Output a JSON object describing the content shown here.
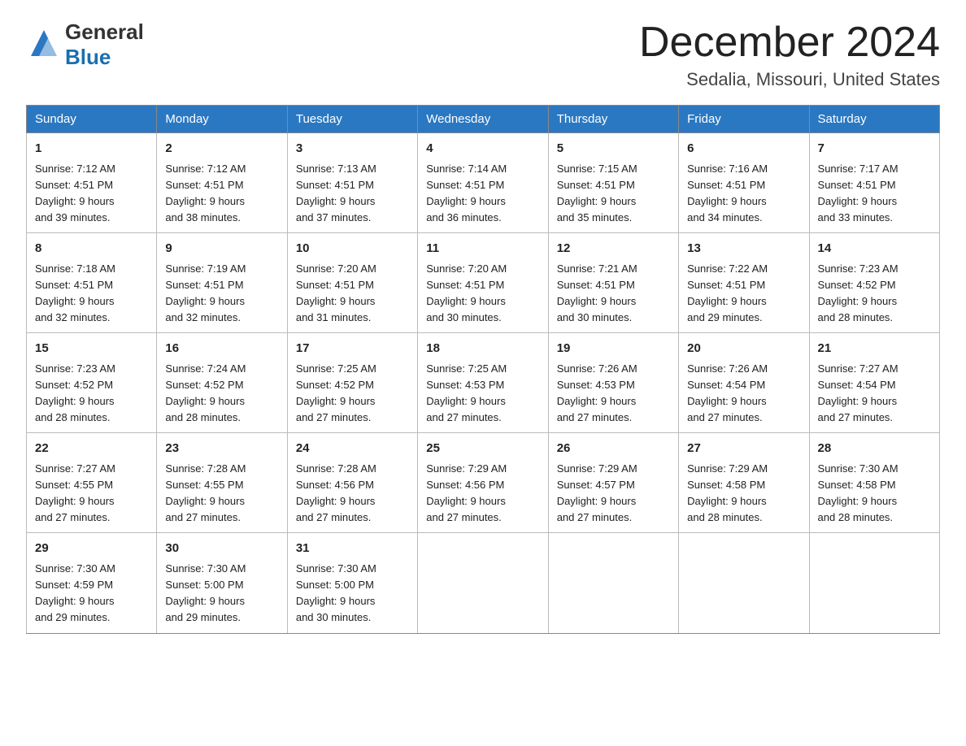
{
  "logo": {
    "general": "General",
    "blue": "Blue"
  },
  "title": {
    "month_year": "December 2024",
    "location": "Sedalia, Missouri, United States"
  },
  "days_of_week": [
    "Sunday",
    "Monday",
    "Tuesday",
    "Wednesday",
    "Thursday",
    "Friday",
    "Saturday"
  ],
  "weeks": [
    [
      {
        "day": "1",
        "sunrise": "7:12 AM",
        "sunset": "4:51 PM",
        "daylight": "9 hours and 39 minutes."
      },
      {
        "day": "2",
        "sunrise": "7:12 AM",
        "sunset": "4:51 PM",
        "daylight": "9 hours and 38 minutes."
      },
      {
        "day": "3",
        "sunrise": "7:13 AM",
        "sunset": "4:51 PM",
        "daylight": "9 hours and 37 minutes."
      },
      {
        "day": "4",
        "sunrise": "7:14 AM",
        "sunset": "4:51 PM",
        "daylight": "9 hours and 36 minutes."
      },
      {
        "day": "5",
        "sunrise": "7:15 AM",
        "sunset": "4:51 PM",
        "daylight": "9 hours and 35 minutes."
      },
      {
        "day": "6",
        "sunrise": "7:16 AM",
        "sunset": "4:51 PM",
        "daylight": "9 hours and 34 minutes."
      },
      {
        "day": "7",
        "sunrise": "7:17 AM",
        "sunset": "4:51 PM",
        "daylight": "9 hours and 33 minutes."
      }
    ],
    [
      {
        "day": "8",
        "sunrise": "7:18 AM",
        "sunset": "4:51 PM",
        "daylight": "9 hours and 32 minutes."
      },
      {
        "day": "9",
        "sunrise": "7:19 AM",
        "sunset": "4:51 PM",
        "daylight": "9 hours and 32 minutes."
      },
      {
        "day": "10",
        "sunrise": "7:20 AM",
        "sunset": "4:51 PM",
        "daylight": "9 hours and 31 minutes."
      },
      {
        "day": "11",
        "sunrise": "7:20 AM",
        "sunset": "4:51 PM",
        "daylight": "9 hours and 30 minutes."
      },
      {
        "day": "12",
        "sunrise": "7:21 AM",
        "sunset": "4:51 PM",
        "daylight": "9 hours and 30 minutes."
      },
      {
        "day": "13",
        "sunrise": "7:22 AM",
        "sunset": "4:51 PM",
        "daylight": "9 hours and 29 minutes."
      },
      {
        "day": "14",
        "sunrise": "7:23 AM",
        "sunset": "4:52 PM",
        "daylight": "9 hours and 28 minutes."
      }
    ],
    [
      {
        "day": "15",
        "sunrise": "7:23 AM",
        "sunset": "4:52 PM",
        "daylight": "9 hours and 28 minutes."
      },
      {
        "day": "16",
        "sunrise": "7:24 AM",
        "sunset": "4:52 PM",
        "daylight": "9 hours and 28 minutes."
      },
      {
        "day": "17",
        "sunrise": "7:25 AM",
        "sunset": "4:52 PM",
        "daylight": "9 hours and 27 minutes."
      },
      {
        "day": "18",
        "sunrise": "7:25 AM",
        "sunset": "4:53 PM",
        "daylight": "9 hours and 27 minutes."
      },
      {
        "day": "19",
        "sunrise": "7:26 AM",
        "sunset": "4:53 PM",
        "daylight": "9 hours and 27 minutes."
      },
      {
        "day": "20",
        "sunrise": "7:26 AM",
        "sunset": "4:54 PM",
        "daylight": "9 hours and 27 minutes."
      },
      {
        "day": "21",
        "sunrise": "7:27 AM",
        "sunset": "4:54 PM",
        "daylight": "9 hours and 27 minutes."
      }
    ],
    [
      {
        "day": "22",
        "sunrise": "7:27 AM",
        "sunset": "4:55 PM",
        "daylight": "9 hours and 27 minutes."
      },
      {
        "day": "23",
        "sunrise": "7:28 AM",
        "sunset": "4:55 PM",
        "daylight": "9 hours and 27 minutes."
      },
      {
        "day": "24",
        "sunrise": "7:28 AM",
        "sunset": "4:56 PM",
        "daylight": "9 hours and 27 minutes."
      },
      {
        "day": "25",
        "sunrise": "7:29 AM",
        "sunset": "4:56 PM",
        "daylight": "9 hours and 27 minutes."
      },
      {
        "day": "26",
        "sunrise": "7:29 AM",
        "sunset": "4:57 PM",
        "daylight": "9 hours and 27 minutes."
      },
      {
        "day": "27",
        "sunrise": "7:29 AM",
        "sunset": "4:58 PM",
        "daylight": "9 hours and 28 minutes."
      },
      {
        "day": "28",
        "sunrise": "7:30 AM",
        "sunset": "4:58 PM",
        "daylight": "9 hours and 28 minutes."
      }
    ],
    [
      {
        "day": "29",
        "sunrise": "7:30 AM",
        "sunset": "4:59 PM",
        "daylight": "9 hours and 29 minutes."
      },
      {
        "day": "30",
        "sunrise": "7:30 AM",
        "sunset": "5:00 PM",
        "daylight": "9 hours and 29 minutes."
      },
      {
        "day": "31",
        "sunrise": "7:30 AM",
        "sunset": "5:00 PM",
        "daylight": "9 hours and 30 minutes."
      },
      null,
      null,
      null,
      null
    ]
  ],
  "labels": {
    "sunrise": "Sunrise:",
    "sunset": "Sunset:",
    "daylight": "Daylight:"
  }
}
